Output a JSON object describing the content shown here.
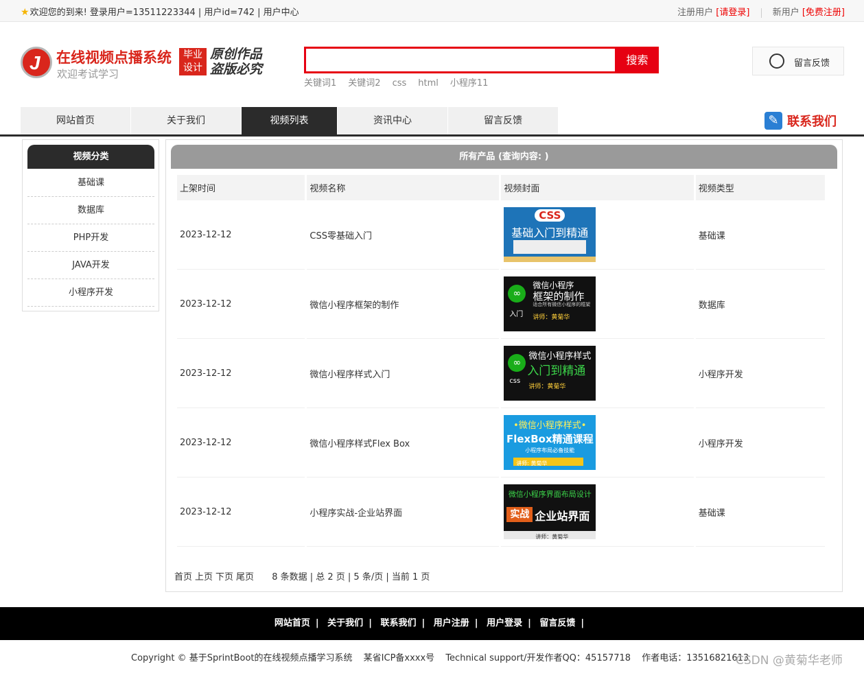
{
  "topbar": {
    "welcome": "欢迎您的到来!  登录用户=13511223344 | 用户id=742 | 用户中心",
    "register_user_label": "注册用户",
    "login_link": "[请登录]",
    "new_user_label": "新用户",
    "free_register_link": "[免费注册]"
  },
  "header": {
    "site_title": "在线视频点播系统",
    "site_subtitle": "欢迎考试学习",
    "badge_line1": "毕业",
    "badge_line2": "设计",
    "slogan_line1": "原创作品",
    "slogan_line2": "盗版必究",
    "search_value": "",
    "search_button": "搜索",
    "keywords": [
      "关键词1",
      "关键词2",
      "css",
      "html",
      "小程序11"
    ],
    "feedback_button": "留言反馈"
  },
  "nav": {
    "items": [
      "网站首页",
      "关于我们",
      "视频列表",
      "资讯中心",
      "留言反馈"
    ],
    "active_index": 2,
    "contact": "联系我们"
  },
  "sidebar": {
    "title": "视频分类",
    "items": [
      "基础课",
      "数据库",
      "PHP开发",
      "JAVA开发",
      "小程序开发"
    ]
  },
  "main": {
    "title": "所有产品 (查询内容: )",
    "columns": [
      "上架时间",
      "视频名称",
      "视频封面",
      "视频类型"
    ],
    "rows": [
      {
        "date": "2023-12-12",
        "name": "CSS零基础入门",
        "type": "基础课",
        "cover": {
          "badge": "CSS",
          "title": "基础入门到精通"
        }
      },
      {
        "date": "2023-12-12",
        "name": "微信小程序框架的制作",
        "type": "数据库",
        "cover": {
          "line1": "微信小程序",
          "line2": "框架的制作",
          "line3": "适合所有微信小程序的框架",
          "teacher": "讲师：黄菊华",
          "tag": "入门"
        }
      },
      {
        "date": "2023-12-12",
        "name": "微信小程序样式入门",
        "type": "小程序开发",
        "cover": {
          "line1": "微信小程序样式",
          "line2": "入门到精通",
          "teacher": "讲师：黄菊华",
          "tag": "css"
        }
      },
      {
        "date": "2023-12-12",
        "name": "微信小程序样式Flex Box",
        "type": "小程序开发",
        "cover": {
          "line1": "•微信小程序样式•",
          "line2": "FlexBox精通课程",
          "line3": "小程序布局必备技能",
          "teacher": "讲师: 黄菊华"
        }
      },
      {
        "date": "2023-12-12",
        "name": "小程序实战-企业站界面",
        "type": "基础课",
        "cover": {
          "line1": "微信小程序界面布局设计",
          "tag": "实战",
          "line2": "企业站界面",
          "teacher": "讲师：黄菊华"
        }
      }
    ],
    "pager": {
      "first": "首页",
      "prev": "上页",
      "next": "下页",
      "last": "尾页",
      "info": "8 条数据 | 总 2 页 | 5 条/页 | 当前 1 页"
    }
  },
  "footer": {
    "links": [
      "网站首页",
      "关于我们",
      "联系我们",
      "用户注册",
      "用户登录",
      "留言反馈"
    ],
    "copyright": "Copyright © 基于SprintBoot的在线视频点播学习系统",
    "icp": "某省ICP备xxxx号",
    "support": "Technical support/开发作者QQ：45157718",
    "phone": "作者电话：13516821613",
    "watermark": "CSDN @黄菊华老师"
  }
}
